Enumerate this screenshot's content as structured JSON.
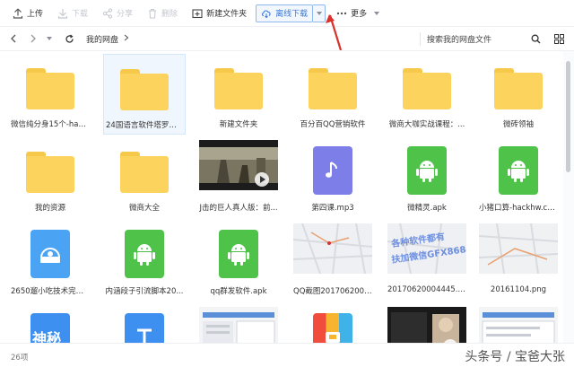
{
  "toolbar": {
    "upload": "上传",
    "download": "下载",
    "share": "分享",
    "delete": "删除",
    "new_folder": "新建文件夹",
    "offline_download": "离线下载",
    "more": "更多"
  },
  "nav": {
    "breadcrumb": "我的网盘",
    "search_placeholder": "搜索我的网盘文件"
  },
  "files": [
    {
      "label": "微信纯分身15个-hac...",
      "type": "folder"
    },
    {
      "label": "24国语言软件塔罗石...",
      "type": "folder",
      "selected": true
    },
    {
      "label": "新建文件夹",
      "type": "folder"
    },
    {
      "label": "百分百QQ营销软件",
      "type": "folder"
    },
    {
      "label": "微商大咖实战课程：...",
      "type": "folder"
    },
    {
      "label": "微砖领袖",
      "type": "folder"
    },
    {
      "label": "我的资源",
      "type": "folder"
    },
    {
      "label": "微商大全",
      "type": "folder"
    },
    {
      "label": "J击的巨人真人版：前...",
      "type": "video"
    },
    {
      "label": "第四课.mp3",
      "type": "music"
    },
    {
      "label": "微精灵.apk",
      "type": "apk"
    },
    {
      "label": "小猪口算-hackhw.co...",
      "type": "apk"
    },
    {
      "label": "2650遛小吃技术完整...",
      "type": "disk"
    },
    {
      "label": "内涵段子引流脚本20...",
      "type": "apk"
    },
    {
      "label": "qq群发软件.apk",
      "type": "apk"
    },
    {
      "label": "QQ截图2017062001...",
      "type": "map"
    },
    {
      "label": "20170620004445.p...",
      "type": "map-text"
    },
    {
      "label": "20161104.png",
      "type": "map"
    },
    {
      "label": "",
      "type": "partial-blue"
    },
    {
      "label": "",
      "type": "partial-t"
    },
    {
      "label": "",
      "type": "partial-screen"
    },
    {
      "label": "",
      "type": "partial-box"
    },
    {
      "label": "",
      "type": "partial-dark"
    },
    {
      "label": "",
      "type": "partial-screen"
    }
  ],
  "thumb_texts": {
    "map_overlay_line1": "各种软件都有",
    "map_overlay_line2": "扶加微信GFX868",
    "partial_blue_text": "神秘"
  },
  "status": {
    "count": "26项",
    "watermark": "头条号 / 宝爸大张"
  },
  "colors": {
    "folder": "#fcd35c",
    "android": "#4fc24a",
    "music": "#7d7ee8",
    "accent": "#3a78d8",
    "annotation": "#d9312b"
  }
}
